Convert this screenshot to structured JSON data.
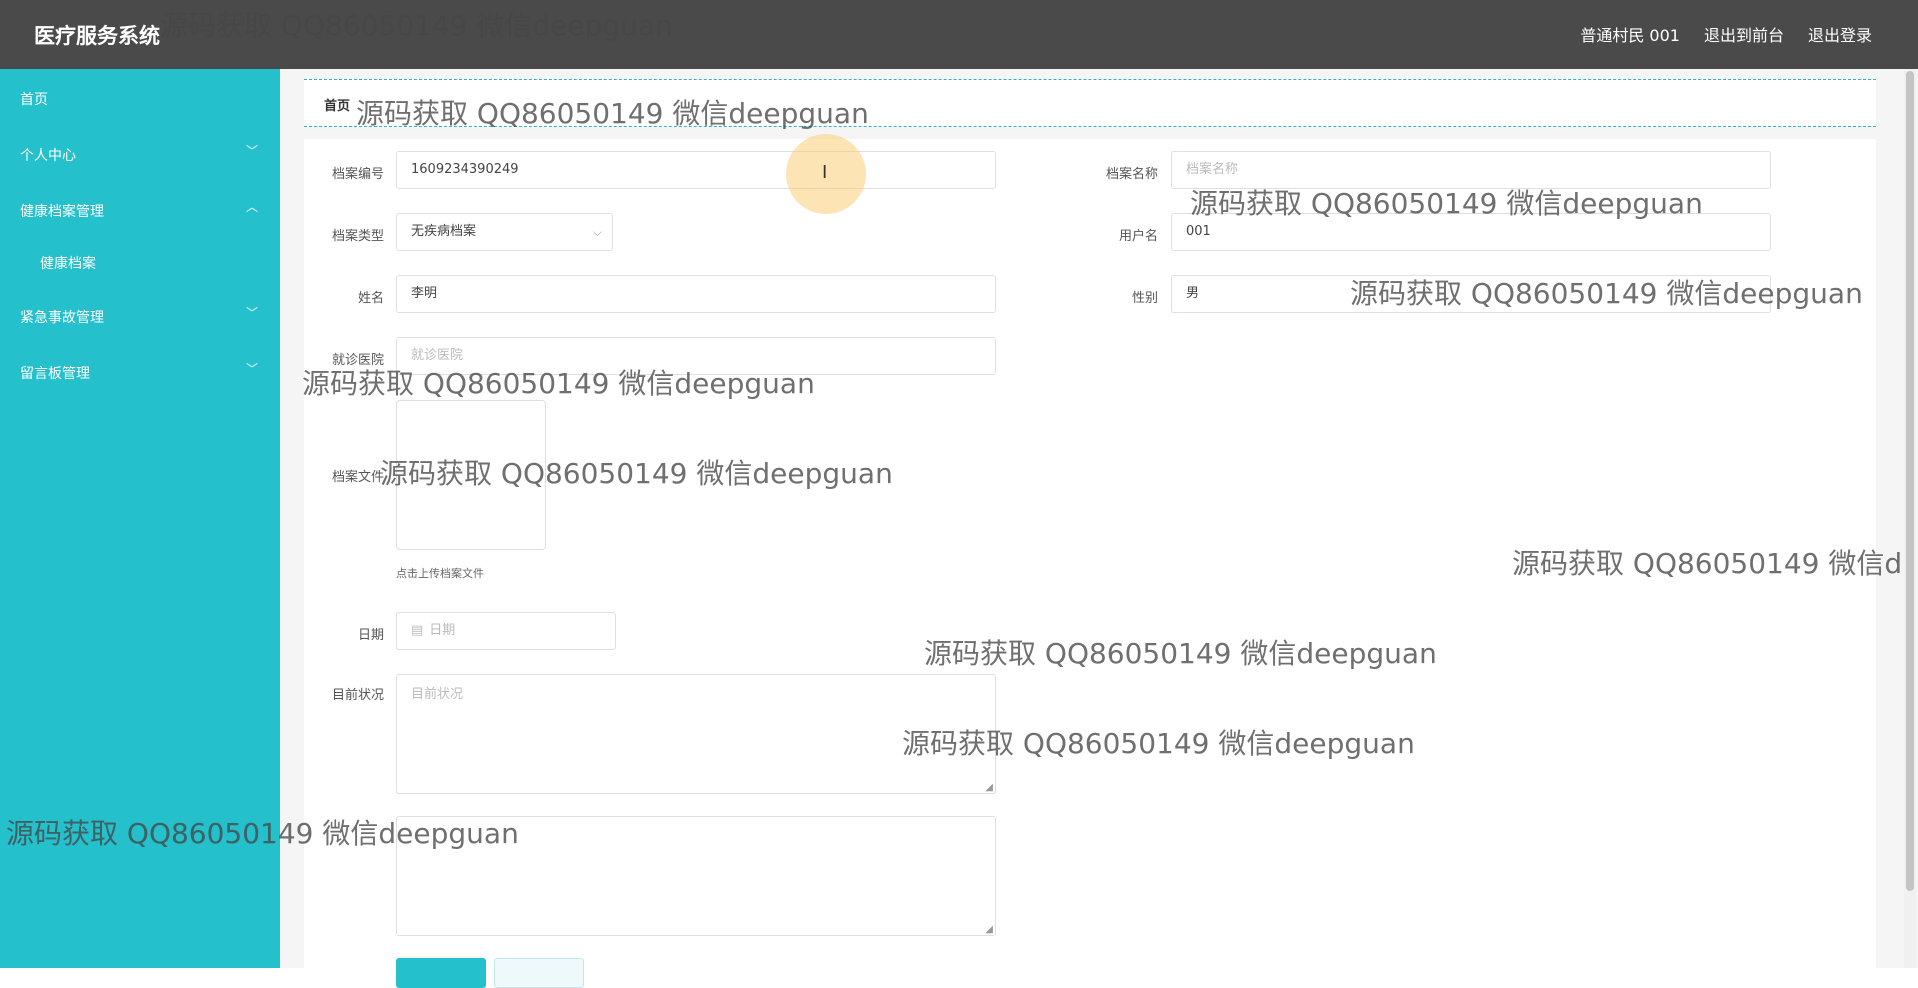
{
  "app": {
    "title": "医疗服务系统"
  },
  "top_links": [
    "普通村民 001",
    "退出到前台",
    "退出登录"
  ],
  "sidebar": {
    "items": [
      {
        "label": "首页",
        "chevron": ""
      },
      {
        "label": "个人中心",
        "chevron": "﹀"
      },
      {
        "label": "健康档案管理",
        "chevron": "︿"
      },
      {
        "label": "健康档案",
        "chevron": ""
      },
      {
        "label": "紧急事故管理",
        "chevron": "﹀"
      },
      {
        "label": "留言板管理",
        "chevron": "﹀"
      }
    ]
  },
  "breadcrumb": {
    "home": "首页"
  },
  "form": {
    "archive_no": {
      "label": "档案编号",
      "value": "1609234390249"
    },
    "archive_name": {
      "label": "档案名称",
      "placeholder": "档案名称"
    },
    "archive_type": {
      "label": "档案类型",
      "value": "无疾病档案",
      "arrow": "⌵"
    },
    "username": {
      "label": "用户名",
      "value": "001"
    },
    "name": {
      "label": "姓名",
      "value": "李明"
    },
    "gender": {
      "label": "性别",
      "value": "男"
    },
    "hospital": {
      "label": "就诊医院",
      "placeholder": "就诊医院"
    },
    "archive_file": {
      "label": "档案文件",
      "hint": "点击上传档案文件"
    },
    "date": {
      "label": "日期",
      "placeholder": "日期"
    },
    "status": {
      "label": "目前状况",
      "placeholder": "目前状况"
    }
  },
  "watermark": "源码获取 QQ86050149 微信deepguan",
  "watermark_clipped": "源码获取 QQ86050149 微信d",
  "icons": [
    "chevron-down-icon",
    "chevron-up-icon",
    "calendar-icon",
    "text-cursor-icon"
  ],
  "colors": {
    "sidebar": "#24c0cc",
    "topbar": "#4a4a4a",
    "accent": "#2ab5c5"
  }
}
